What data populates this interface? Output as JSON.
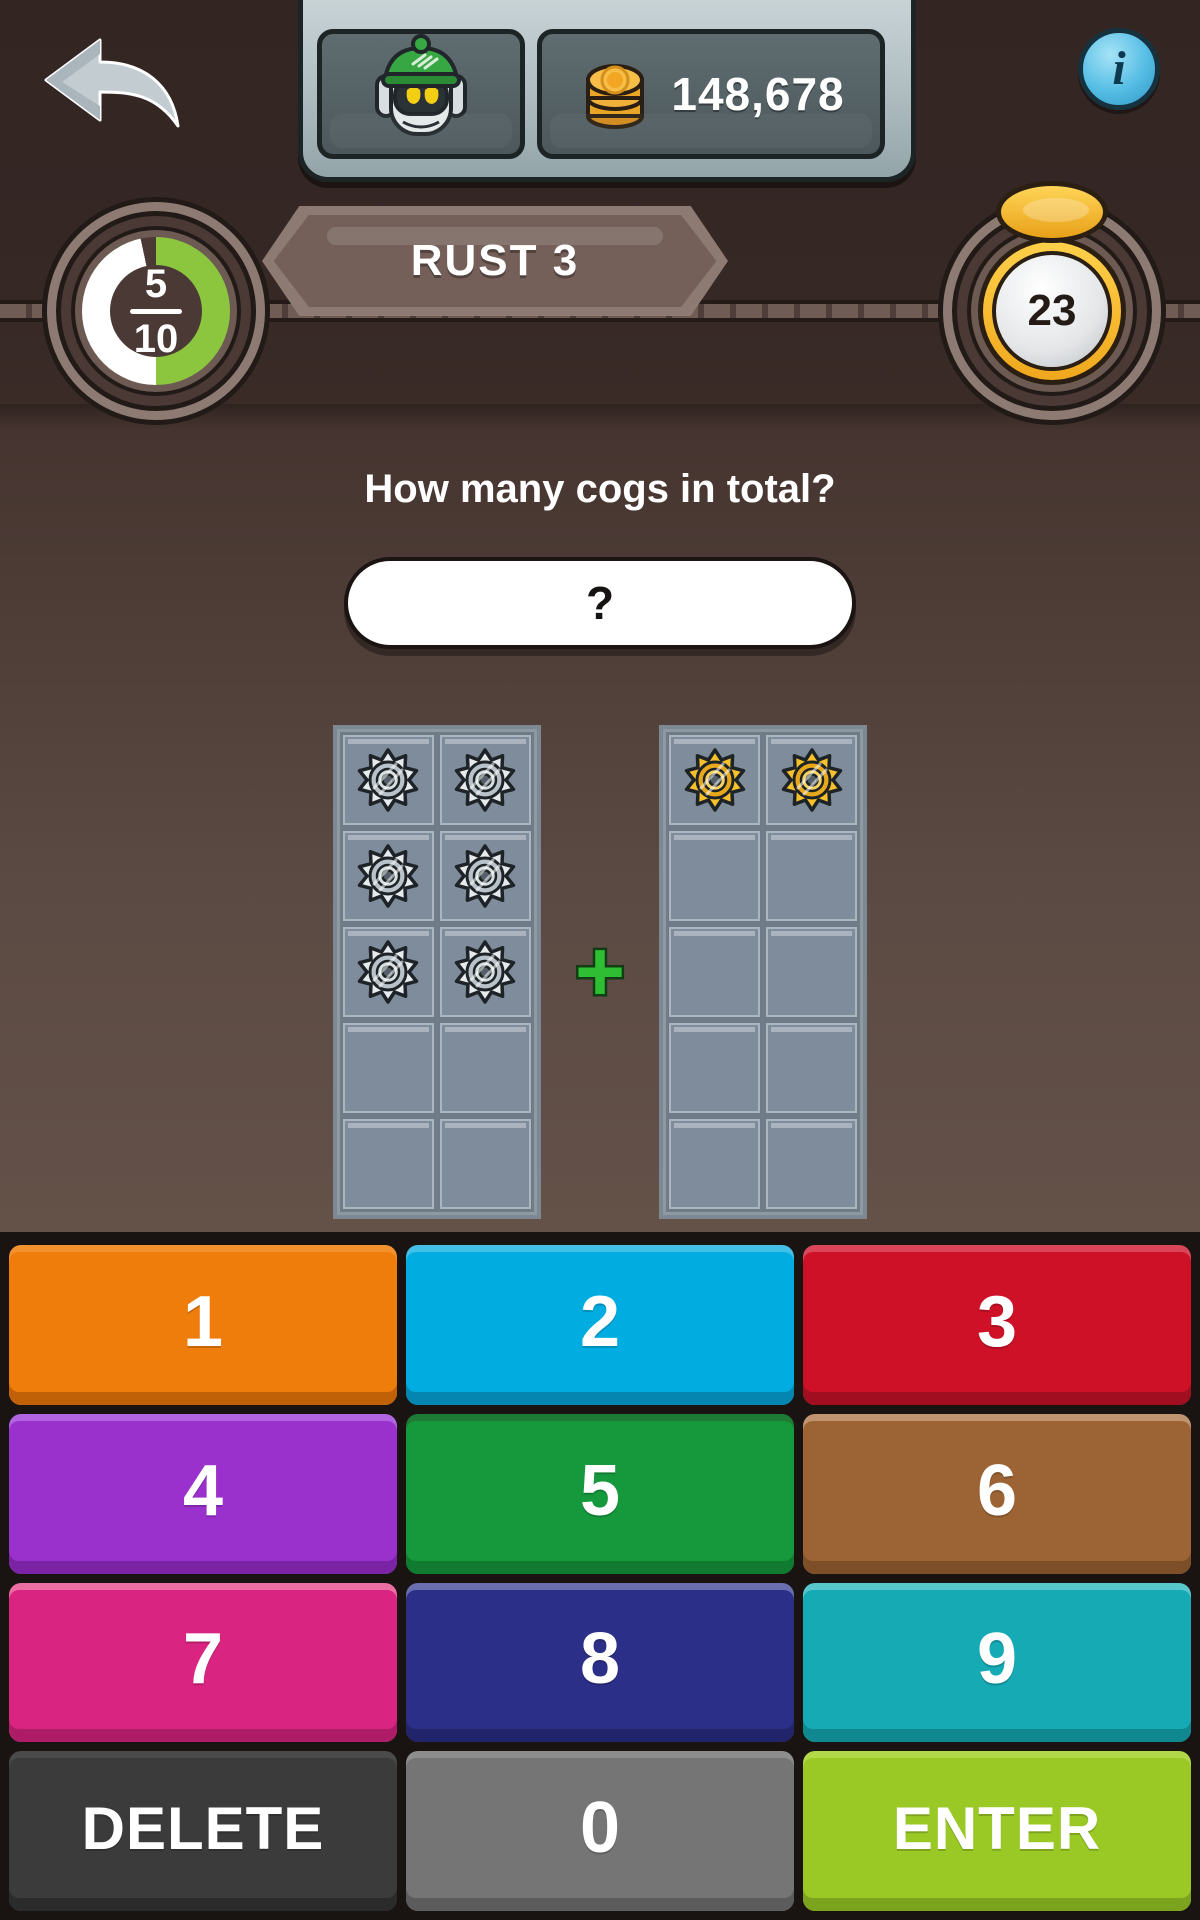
{
  "header": {
    "back_button": "back-arrow",
    "avatar_label": "player-avatar",
    "coin_icon": "coin-stack-icon",
    "coin_count": "148,678",
    "info_button": "i"
  },
  "status_bar": {
    "progress": {
      "current": "5",
      "total": "10",
      "fraction_text": "5/10",
      "percent_complete": 50,
      "fill_color": "#8cc63f",
      "track_color": "#ffffff"
    },
    "title": "RUST 3",
    "level_badge": {
      "value": "23",
      "coin_color": "#f0a81d"
    }
  },
  "question": {
    "prompt": "How many cogs in total?",
    "answer_value": "?",
    "answer_placeholder": "?"
  },
  "puzzle": {
    "operator": "+",
    "operator_color": "#2fbd33",
    "grid_columns": 2,
    "grid_rows": 5,
    "left_group": {
      "cog_color": "silver",
      "filled_count": 6,
      "cells": [
        [
          "cog",
          "cog"
        ],
        [
          "cog",
          "cog"
        ],
        [
          "cog",
          "cog"
        ],
        [
          "empty",
          "empty"
        ],
        [
          "empty",
          "empty"
        ]
      ]
    },
    "right_group": {
      "cog_color": "gold",
      "filled_count": 2,
      "cells": [
        [
          "cog",
          "cog"
        ],
        [
          "empty",
          "empty"
        ],
        [
          "empty",
          "empty"
        ],
        [
          "empty",
          "empty"
        ],
        [
          "empty",
          "empty"
        ]
      ]
    }
  },
  "keypad": {
    "keys": [
      {
        "label": "1",
        "kind": "num",
        "name": "key-1",
        "top": "#f2922e",
        "face": "#ef7d0b",
        "lip": "#c06107"
      },
      {
        "label": "2",
        "kind": "num",
        "name": "key-2",
        "top": "#44c0e8",
        "face": "#00ace0",
        "lip": "#0586b0"
      },
      {
        "label": "3",
        "kind": "num",
        "name": "key-3",
        "top": "#d9465a",
        "face": "#cf1128",
        "lip": "#a00e20"
      },
      {
        "label": "4",
        "kind": "num",
        "name": "key-4",
        "top": "#b165e0",
        "face": "#9a31cd",
        "lip": "#7a23a5"
      },
      {
        "label": "5",
        "kind": "num",
        "name": "key-5",
        "top": "#1e7b35",
        "face": "#16993d",
        "lip": "#107a30"
      },
      {
        "label": "6",
        "kind": "num",
        "name": "key-6",
        "top": "#c19471",
        "face": "#9c6434",
        "lip": "#7d4f28"
      },
      {
        "label": "7",
        "kind": "num",
        "name": "key-7",
        "top": "#ec6fa3",
        "face": "#da2482",
        "lip": "#ae1c68"
      },
      {
        "label": "8",
        "kind": "num",
        "name": "key-8",
        "top": "#6b6fb0",
        "face": "#2c2f87",
        "lip": "#22246b"
      },
      {
        "label": "9",
        "kind": "num",
        "name": "key-9",
        "top": "#57c7cc",
        "face": "#15aab4",
        "lip": "#10888f"
      },
      {
        "label": "DELETE",
        "kind": "word",
        "name": "key-delete",
        "top": "#4a4a4a",
        "face": "#3b3b3b",
        "lip": "#2b2b2b"
      },
      {
        "label": "0",
        "kind": "num",
        "name": "key-0",
        "top": "#8d8d8d",
        "face": "#757575",
        "lip": "#5c5c5c"
      },
      {
        "label": "ENTER",
        "kind": "word",
        "name": "key-enter",
        "top": "#b2d84a",
        "face": "#9ac926",
        "lip": "#7ba31d"
      }
    ]
  },
  "theme": {
    "background_dark": "#33251f",
    "background_play": "#5b4a43",
    "keypad_background": "#191412"
  }
}
